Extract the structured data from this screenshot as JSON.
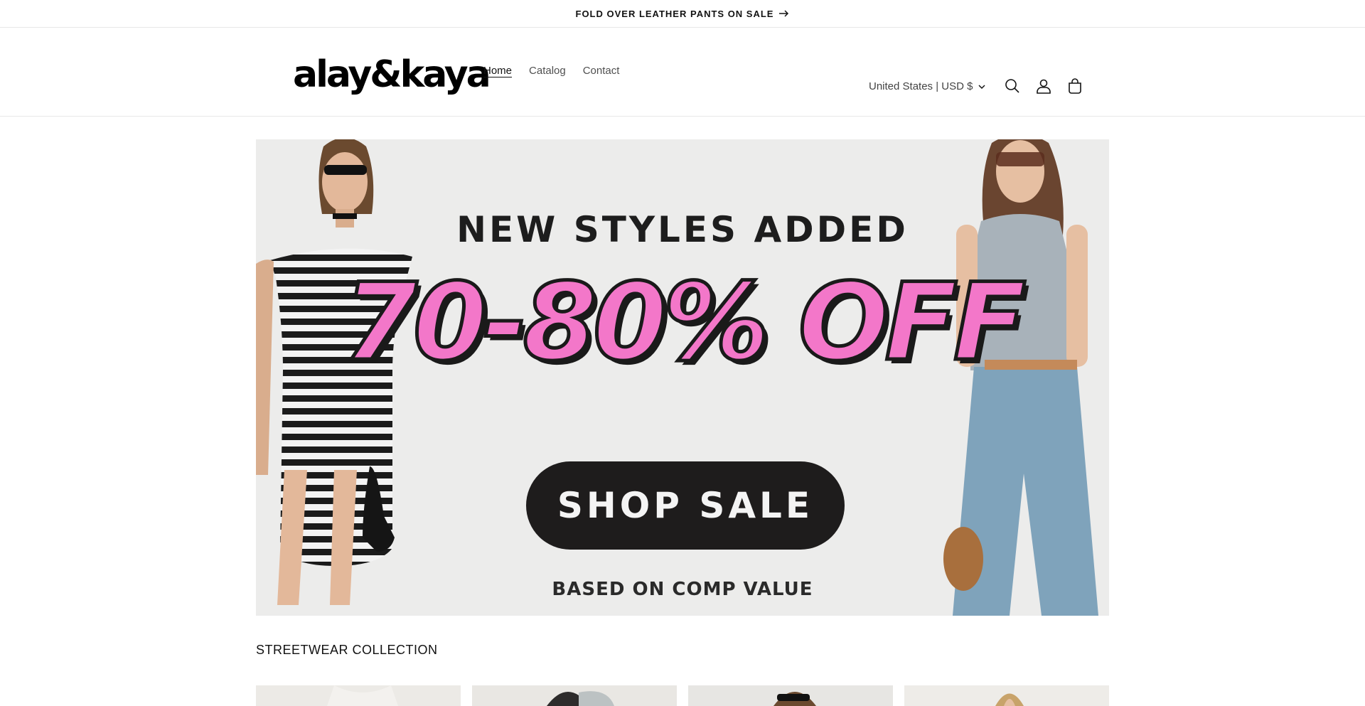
{
  "announcement": {
    "text": "FOLD OVER LEATHER PANTS ON SALE",
    "icon": "arrow-right-icon"
  },
  "header": {
    "logo": "alay&kaya",
    "nav": [
      {
        "label": "Home",
        "active": true
      },
      {
        "label": "Catalog",
        "active": false
      },
      {
        "label": "Contact",
        "active": false
      }
    ],
    "country_selector": "United States | USD $",
    "icons": [
      "search-icon",
      "account-icon",
      "cart-icon"
    ]
  },
  "hero": {
    "headline": "NEW STYLES ADDED",
    "discount": "70-80% OFF",
    "cta": "SHOP SALE",
    "footnote": "BASED ON COMP VALUE",
    "colors": {
      "background": "#ececeb",
      "discount_fill": "#f377c9",
      "button": "#1e1c1c"
    }
  },
  "collection": {
    "title": "STREETWEAR COLLECTION",
    "product_count_visible": 4
  }
}
